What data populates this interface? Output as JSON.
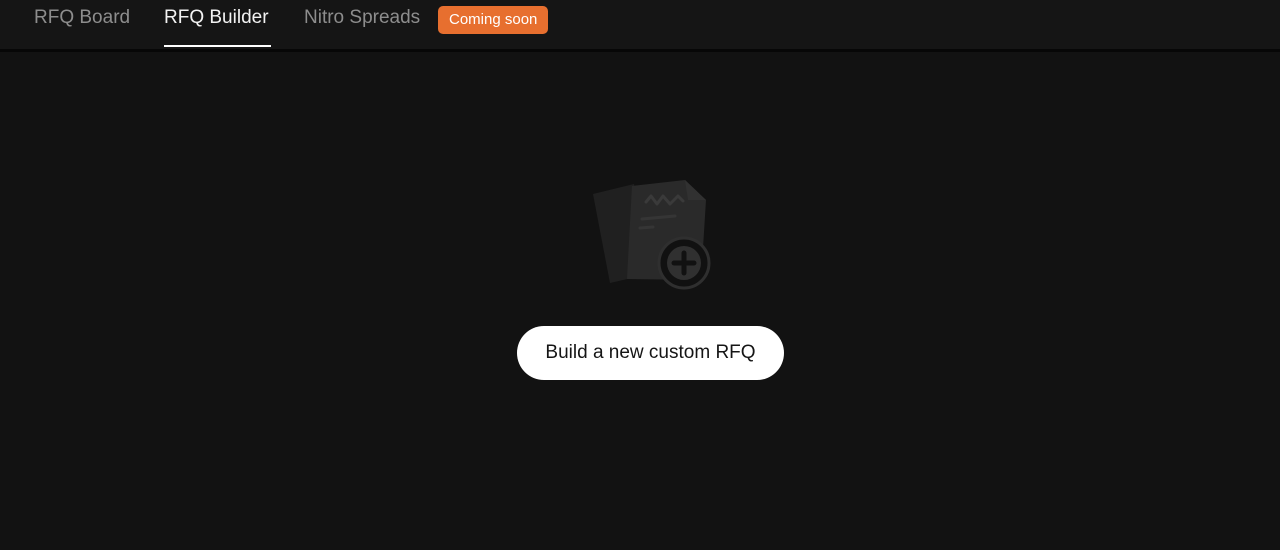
{
  "tabs": [
    {
      "label": "RFQ Board",
      "active": false
    },
    {
      "label": "RFQ Builder",
      "active": true
    },
    {
      "label": "Nitro Spreads",
      "active": false,
      "badge": "Coming soon"
    }
  ],
  "colors": {
    "background": "#121212",
    "tabbar": "#151515",
    "badge": "#e76f2f",
    "button": "#ffffff"
  },
  "empty_state": {
    "icon": "new-document-icon",
    "button_label": "Build a new custom RFQ"
  }
}
